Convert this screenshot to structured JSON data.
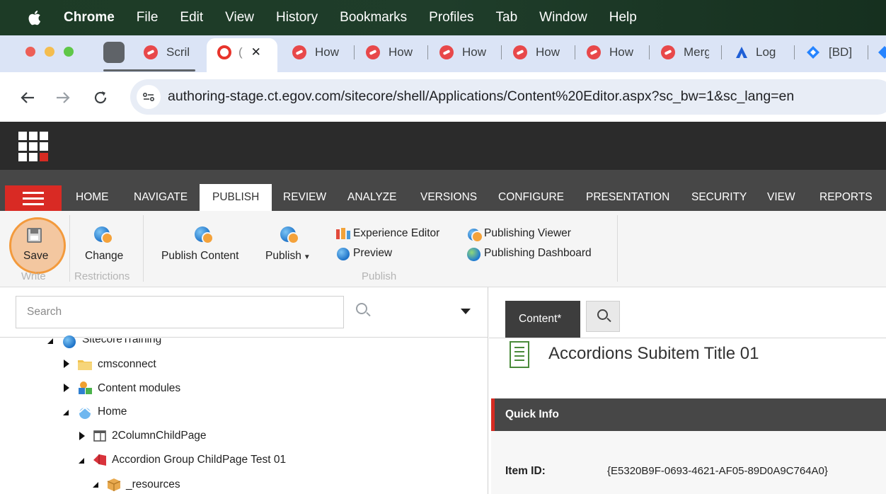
{
  "os_menubar": {
    "app": "Chrome",
    "items": [
      "File",
      "Edit",
      "View",
      "History",
      "Bookmarks",
      "Profiles",
      "Tab",
      "Window",
      "Help"
    ]
  },
  "browser": {
    "tabs": [
      {
        "label": "Scril",
        "favicon": "scribe-icon"
      },
      {
        "label": "(",
        "favicon": "opera-icon",
        "active": true
      },
      {
        "label": "How",
        "favicon": "scribe-icon"
      },
      {
        "label": "How",
        "favicon": "scribe-icon"
      },
      {
        "label": "How",
        "favicon": "scribe-icon"
      },
      {
        "label": "How",
        "favicon": "scribe-icon"
      },
      {
        "label": "How",
        "favicon": "scribe-icon"
      },
      {
        "label": "Merg",
        "favicon": "scribe-icon"
      },
      {
        "label": "Log",
        "favicon": "atlassian-icon"
      },
      {
        "label": "[BD]",
        "favicon": "jira-icon"
      }
    ],
    "close_glyph": "✕",
    "url": "authoring-stage.ct.egov.com/sitecore/shell/Applications/Content%20Editor.aspx?sc_bw=1&sc_lang=en"
  },
  "sitecore": {
    "nav_tabs": [
      "HOME",
      "NAVIGATE",
      "PUBLISH",
      "REVIEW",
      "ANALYZE",
      "VERSIONS",
      "CONFIGURE",
      "PRESENTATION",
      "SECURITY",
      "VIEW",
      "REPORTS"
    ],
    "active_tab": "PUBLISH",
    "ribbon": {
      "save": "Save",
      "change": "Change",
      "publish_content": "Publish Content",
      "publish": "Publish",
      "experience_editor": "Experience Editor",
      "preview": "Preview",
      "publishing_viewer": "Publishing Viewer",
      "publishing_dashboard": "Publishing Dashboard",
      "groups": {
        "write": "Write",
        "restrictions": "Restrictions",
        "publish": "Publish"
      }
    },
    "search": {
      "placeholder": "Search"
    },
    "tree": [
      {
        "label": "SitecoreTraining",
        "icon": "globe-icon",
        "expanded": true
      },
      {
        "label": "cmsconnect",
        "icon": "folder-icon",
        "expanded": false
      },
      {
        "label": "Content modules",
        "icon": "modules-icon",
        "expanded": false
      },
      {
        "label": "Home",
        "icon": "home-globe-icon",
        "expanded": true
      },
      {
        "label": "2ColumnChildPage",
        "icon": "page-icon",
        "expanded": false
      },
      {
        "label": "Accordion Group ChildPage Test 01",
        "icon": "accordion-icon",
        "expanded": true
      },
      {
        "label": "_resources",
        "icon": "box-icon",
        "expanded": true
      }
    ],
    "editor": {
      "content_tab": "Content*",
      "item_title": "Accordions Subitem Title 01",
      "quick_info": "Quick Info",
      "item_id_label": "Item ID:",
      "item_id": "{E5320B9F-0693-4621-AF05-89D0A9C764A0}"
    }
  },
  "colors": {
    "sitecore_red": "#d62b22",
    "save_highlight": "#f39a3c"
  }
}
